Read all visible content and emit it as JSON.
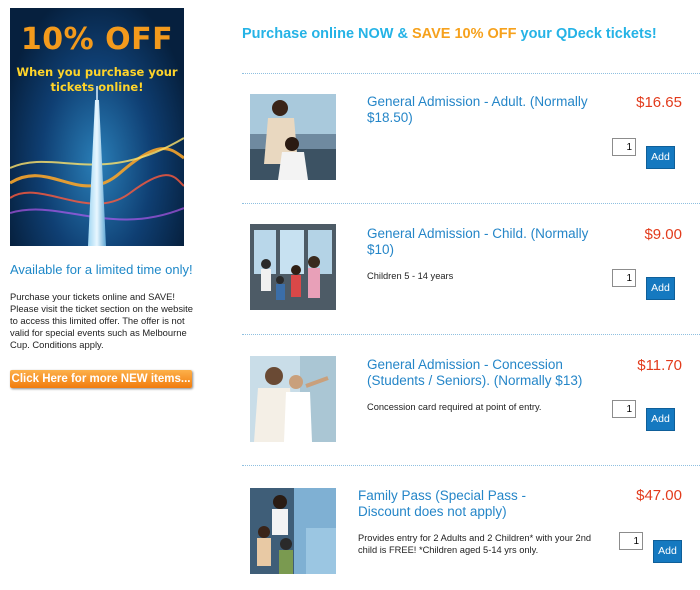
{
  "promo": {
    "banner_percent": "10% OFF",
    "banner_line1": "When you purchase your",
    "banner_line2": "tickets online!",
    "limited_text": "Available for a limited time only!",
    "description": [
      "Purchase your tickets online and SAVE!",
      "Please visit the ticket section on the website to access this limited offer. The offer is not valid for special events such as Melbourne Cup. Conditions apply."
    ],
    "more_button": "Click Here for more NEW items..."
  },
  "headline": {
    "part1": "Purchase online NOW & ",
    "highlight": "SAVE 10% OFF",
    "part2": " your QDeck tickets!"
  },
  "products": [
    {
      "title": "General Admission - Adult. (Normally $18.50)",
      "price": "$16.65",
      "note": "",
      "qty": "1",
      "add_label": "Add"
    },
    {
      "title": "General Admission - Child. (Normally $10)",
      "price": "$9.00",
      "note": "Children 5 - 14 years",
      "qty": "1",
      "add_label": "Add"
    },
    {
      "title": "General Admission - Concession (Students / Seniors). (Normally $13)",
      "price": "$11.70",
      "note": "Concession card required at point of entry.",
      "qty": "1",
      "add_label": "Add"
    },
    {
      "title": "Family Pass (Special Pass - Discount does not apply)",
      "price": "$47.00",
      "note": "Provides entry for 2 Adults and 2 Children* with your 2nd child is FREE! *Children aged 5-14 yrs only.",
      "qty": "1",
      "add_label": "Add"
    }
  ],
  "colors": {
    "accent_blue": "#2586c8",
    "headline_cyan": "#25b3e6",
    "price_red": "#e23b1c",
    "orange": "#f6a11c",
    "add_button": "#1579c0"
  }
}
